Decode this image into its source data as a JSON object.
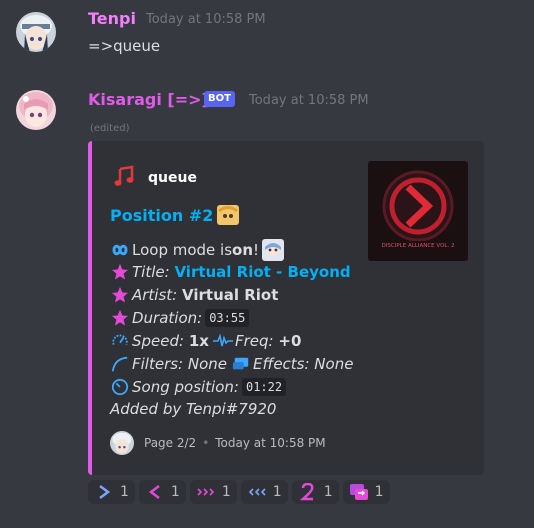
{
  "messages": [
    {
      "username": "Tenpi",
      "username_color": "#f47fff",
      "timestamp": "Today at 10:58 PM",
      "content": "=>queue"
    },
    {
      "username": "Kisaragi [=>]",
      "username_color": "#e05be9",
      "bot_tag": "BOT",
      "timestamp": "Today at 10:58 PM",
      "edited": "(edited)"
    }
  ],
  "embed": {
    "accent_color": "#e05be9",
    "author_icon": "music-note-icon",
    "author": "queue",
    "title": "Position #2",
    "loop": {
      "icon": "infinity-icon",
      "text": "Loop mode is ",
      "value": "on",
      "suffix": "!"
    },
    "title_line": {
      "icon": "star-icon",
      "label": "Title:",
      "value": "Virtual Riot - Beyond"
    },
    "artist_line": {
      "icon": "star-icon",
      "label": "Artist:",
      "value": "Virtual Riot"
    },
    "duration_line": {
      "icon": "star-icon",
      "label": "Duration:",
      "value": "03:55"
    },
    "speed_line": {
      "speed_icon": "speedometer-icon",
      "speed_label": "Speed:",
      "speed_value": "1x",
      "freq_icon": "waveform-icon",
      "freq_label": "Freq:",
      "freq_value": "+0"
    },
    "filters_line": {
      "filters_icon": "curve-icon",
      "filters_text": "Filters: None",
      "effects_icon": "monitor-icon",
      "effects_text": "Effects: None"
    },
    "position_line": {
      "icon": "clock-icon",
      "label": "Song position:",
      "value": "01:22"
    },
    "added_by": "Added by Tenpi#7920",
    "thumbnail_text": "DISCIPLE ALLIANCE VOL. 2",
    "footer": {
      "page": "Page 2/2",
      "separator": "•",
      "timestamp": "Today at 10:58 PM"
    }
  },
  "reactions": [
    {
      "icon": "right-arrow-icon",
      "count": "1"
    },
    {
      "icon": "left-arrow-icon",
      "count": "1"
    },
    {
      "icon": "fast-forward-icon",
      "count": "1"
    },
    {
      "icon": "rewind-icon",
      "count": "1"
    },
    {
      "icon": "number-2-icon",
      "count": "1"
    },
    {
      "icon": "repeat-icon",
      "count": "1"
    }
  ]
}
